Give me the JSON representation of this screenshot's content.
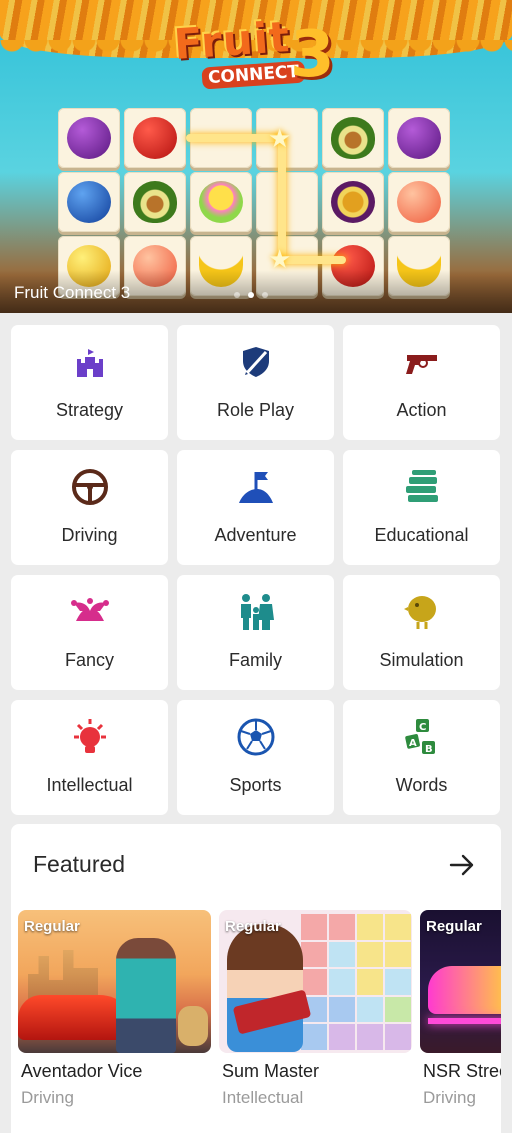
{
  "banner": {
    "title": "Fruit Connect 3",
    "logo_word1": "Fruit",
    "logo_word2": "CONNECT",
    "logo_number": "3",
    "page_dots": 3,
    "active_dot": 1
  },
  "categories": [
    {
      "label": "Strategy",
      "icon": "castle-icon",
      "color": "#6b3fc9"
    },
    {
      "label": "Role Play",
      "icon": "shield-sword-icon",
      "color": "#1d3b7a"
    },
    {
      "label": "Action",
      "icon": "revolver-icon",
      "color": "#8a1c1c"
    },
    {
      "label": "Driving",
      "icon": "steering-wheel-icon",
      "color": "#5b2a1a"
    },
    {
      "label": "Adventure",
      "icon": "flag-hill-icon",
      "color": "#1f4fb8"
    },
    {
      "label": "Educational",
      "icon": "books-icon",
      "color": "#2f9e76"
    },
    {
      "label": "Fancy",
      "icon": "jester-hat-icon",
      "color": "#d62d8c"
    },
    {
      "label": "Family",
      "icon": "family-icon",
      "color": "#1e8c8c"
    },
    {
      "label": "Simulation",
      "icon": "chick-icon",
      "color": "#c7a51a"
    },
    {
      "label": "Intellectual",
      "icon": "lightbulb-icon",
      "color": "#e8323c"
    },
    {
      "label": "Sports",
      "icon": "soccer-ball-icon",
      "color": "#1a55b0"
    },
    {
      "label": "Words",
      "icon": "letter-blocks-icon",
      "color": "#2e8b3e"
    }
  ],
  "featured": {
    "title": "Featured",
    "items": [
      {
        "tag": "Regular",
        "name": "Aventador Vice",
        "category": "Driving"
      },
      {
        "tag": "Regular",
        "name": "Sum Master",
        "category": "Intellectual"
      },
      {
        "tag": "Regular",
        "name": "NSR Street",
        "category": "Driving"
      }
    ]
  }
}
